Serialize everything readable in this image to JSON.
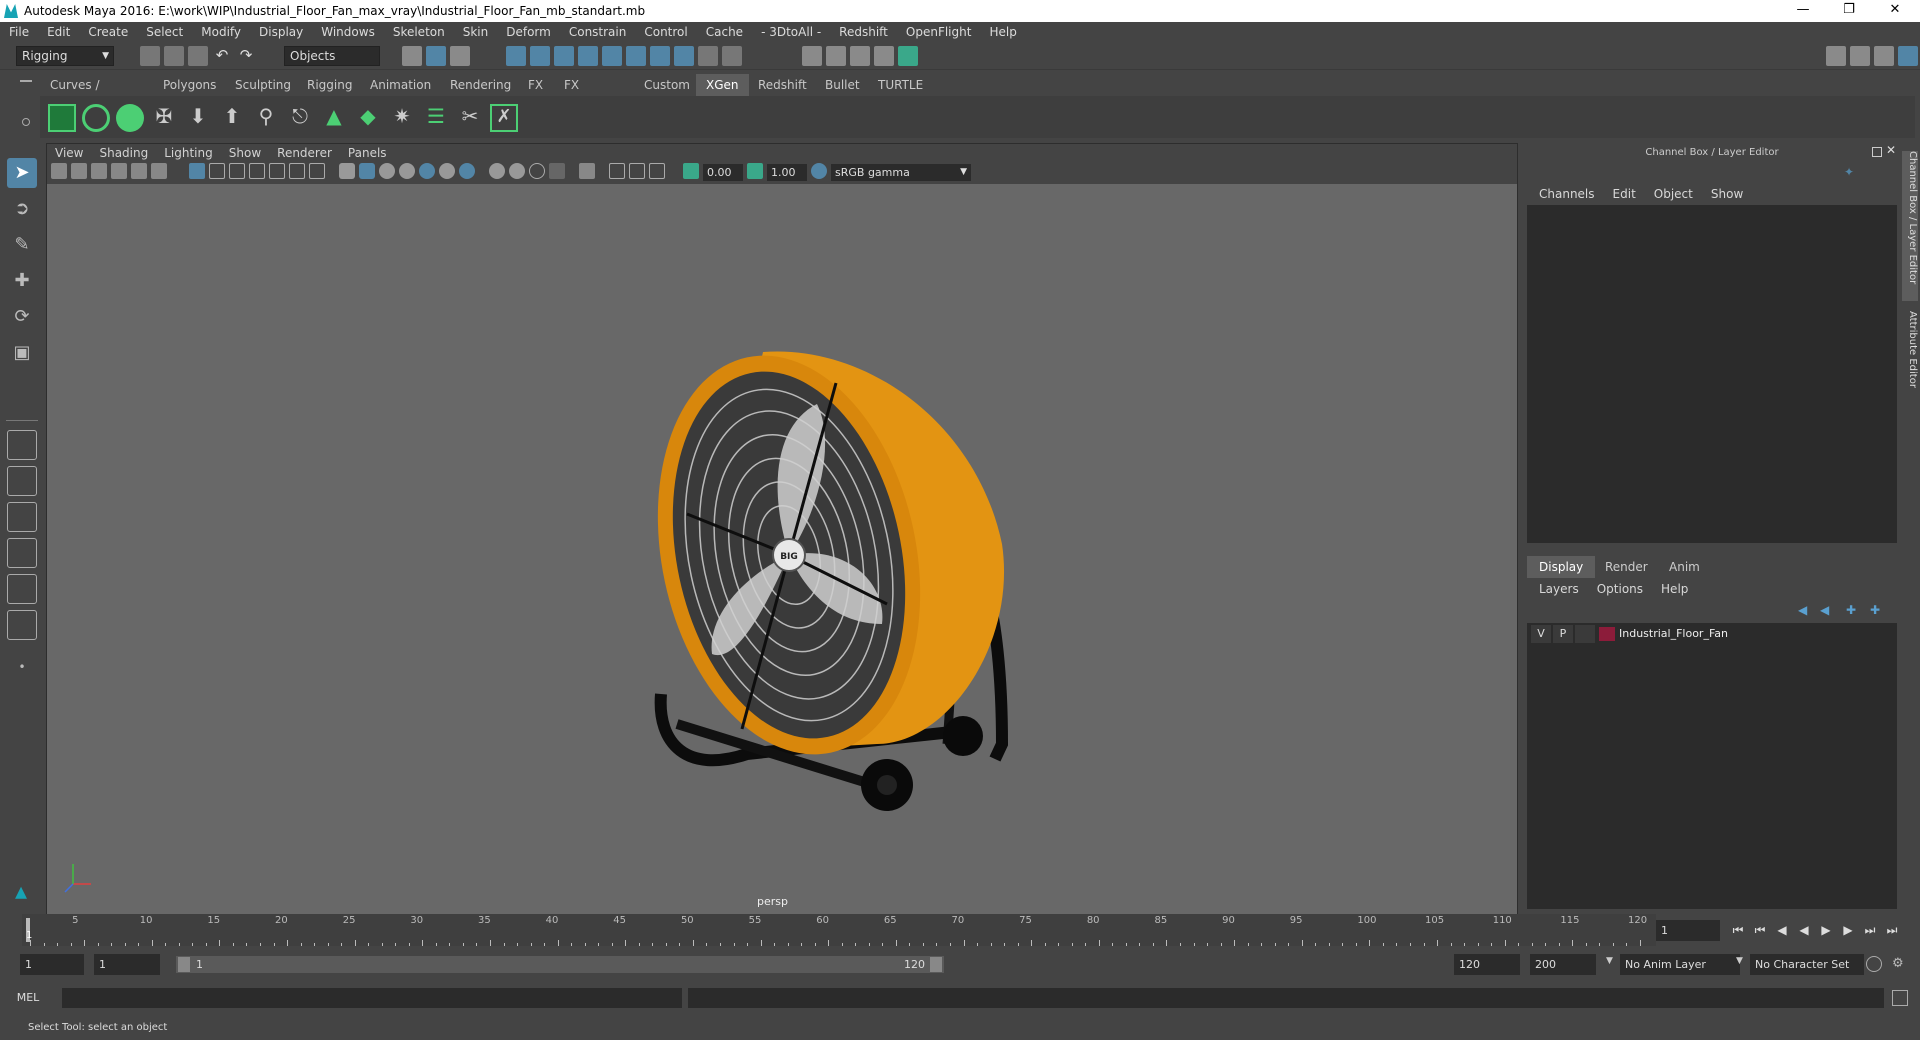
{
  "titlebar": {
    "title": "Autodesk Maya 2016: E:\\work\\WIP\\Industrial_Floor_Fan_max_vray\\Industrial_Floor_Fan_mb_standart.mb"
  },
  "menubar": [
    "File",
    "Edit",
    "Create",
    "Select",
    "Modify",
    "Display",
    "Windows",
    "Skeleton",
    "Skin",
    "Deform",
    "Constrain",
    "Control",
    "Cache",
    "- 3DtoAll -",
    "Redshift",
    "OpenFlight",
    "Help"
  ],
  "status": {
    "menuset": "Rigging",
    "selection_mode": "Objects"
  },
  "shelf": {
    "tabs": [
      "Curves / Surfaces",
      "Polygons",
      "Sculpting",
      "Rigging",
      "Animation",
      "Rendering",
      "FX",
      "FX Caching",
      "Custom",
      "XGen",
      "Redshift",
      "Bullet",
      "TURTLE"
    ],
    "active": "XGen"
  },
  "panel": {
    "menu": [
      "View",
      "Shading",
      "Lighting",
      "Show",
      "Renderer",
      "Panels"
    ],
    "exposure": "0.00",
    "gamma": "1.00",
    "colorspace": "sRGB gamma",
    "camera": "persp",
    "model_badge": "BIG"
  },
  "channelbox": {
    "title": "Channel Box / Layer Editor",
    "menu": [
      "Channels",
      "Edit",
      "Object",
      "Show"
    ]
  },
  "layereditor": {
    "tabs": [
      "Display",
      "Render",
      "Anim"
    ],
    "active": "Display",
    "menu": [
      "Layers",
      "Options",
      "Help"
    ],
    "layers": [
      {
        "v": "V",
        "p": "P",
        "name": "Industrial_Floor_Fan",
        "color": "#8c1c3a"
      }
    ]
  },
  "sidetabs": {
    "channel_box": "Channel Box / Layer Editor",
    "attribute_editor": "Attribute Editor"
  },
  "timeline": {
    "labels": [
      "1",
      "5",
      "10",
      "15",
      "20",
      "25",
      "30",
      "35",
      "40",
      "45",
      "50",
      "55",
      "60",
      "65",
      "70",
      "75",
      "80",
      "85",
      "90",
      "95",
      "100",
      "105",
      "110",
      "115",
      "120"
    ],
    "current_frame": "1"
  },
  "range": {
    "start": "1",
    "playback_start": "1",
    "slider_start": "1",
    "slider_end": "120",
    "playback_end": "120",
    "end": "200",
    "anim_layer": "No Anim Layer",
    "character_set": "No Character Set"
  },
  "cmdline": {
    "label": "MEL"
  },
  "helpline": {
    "text": "Select Tool: select an object"
  },
  "colors": {
    "accent": "#5285a6",
    "fan_body": "#e89b14",
    "layer_color": "#8c1c3a"
  }
}
